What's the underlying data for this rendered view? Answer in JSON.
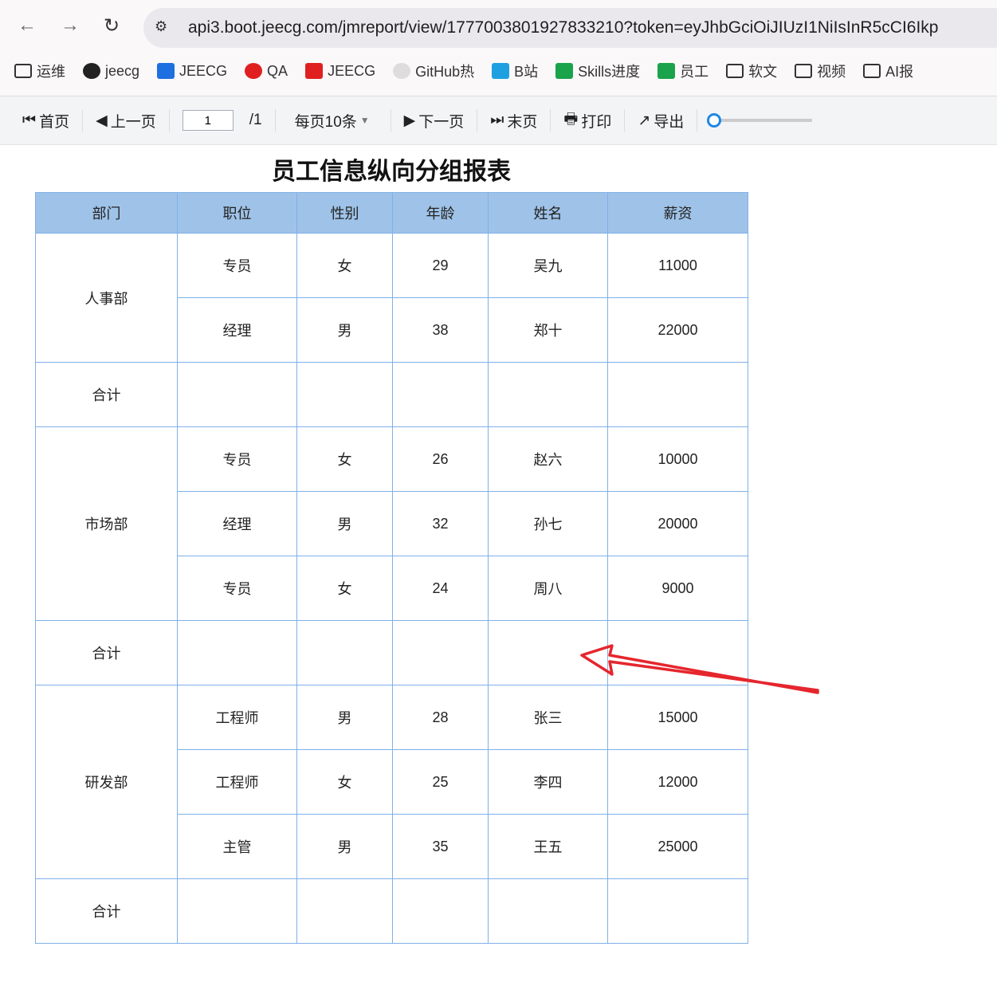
{
  "browser": {
    "url": "api3.boot.jeecg.com/jmreport/view/1777003801927833210?token=eyJhbGciOiJIUzI1NiIsInR5cCI6Ikp",
    "bookmarks": [
      "运维",
      "jeecg",
      "JEECG",
      "QA",
      "JEECG",
      "GitHub热",
      "B站",
      "Skills进度",
      "员工",
      "软文",
      "视频",
      "AI报"
    ]
  },
  "toolbar": {
    "first": "首页",
    "prev": "上一页",
    "page": "1",
    "total": "/1",
    "page_size": "每页10条",
    "next": "下一页",
    "last": "末页",
    "print": "打印",
    "export": "导出",
    "zoom_level": 0
  },
  "report": {
    "title": "员工信息纵向分组报表",
    "headers": [
      "部门",
      "职位",
      "性别",
      "年龄",
      "姓名",
      "薪资"
    ],
    "subtotal_label": "合计",
    "groups": [
      {
        "dept": "人事部",
        "rows": [
          [
            "专员",
            "女",
            "29",
            "吴九",
            "11000"
          ],
          [
            "经理",
            "男",
            "38",
            "郑十",
            "22000"
          ]
        ]
      },
      {
        "dept": "市场部",
        "rows": [
          [
            "专员",
            "女",
            "26",
            "赵六",
            "10000"
          ],
          [
            "经理",
            "男",
            "32",
            "孙七",
            "20000"
          ],
          [
            "专员",
            "女",
            "24",
            "周八",
            "9000"
          ]
        ]
      },
      {
        "dept": "研发部",
        "rows": [
          [
            "工程师",
            "男",
            "28",
            "张三",
            "15000"
          ],
          [
            "工程师",
            "女",
            "25",
            "李四",
            "12000"
          ],
          [
            "主管",
            "男",
            "35",
            "王五",
            "25000"
          ]
        ]
      }
    ]
  },
  "colors": {
    "header": "#9fc3e8",
    "border": "#7fb0e8",
    "arrow": "#e5262d"
  }
}
